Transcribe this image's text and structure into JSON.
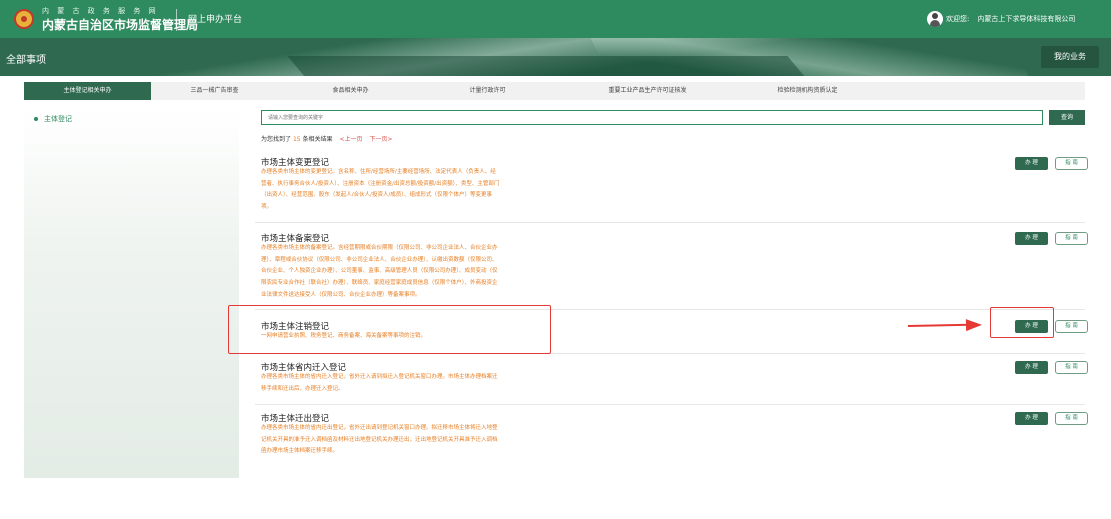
{
  "header": {
    "brand_subtitle": "内 蒙 古 政 务 服 务 网",
    "brand_title": "内蒙古自治区市场监督管理局",
    "platform_label": "网上申办平台",
    "welcome_text": "欢迎您:",
    "company_name": "内蒙古上下求导体科技有限公司"
  },
  "banner": {
    "all_items_label": "全部事项",
    "my_business_label": "我的业务"
  },
  "tabs": [
    {
      "label": "主体登记相关申办",
      "active": true
    },
    {
      "label": "三品一械广告审查",
      "active": false
    },
    {
      "label": "食品相关申办",
      "active": false
    },
    {
      "label": "计量行政许可",
      "active": false
    },
    {
      "label": "重要工业产品生产许可证核发",
      "active": false
    },
    {
      "label": "检验检测机构资质认定",
      "active": false
    }
  ],
  "sidebar": {
    "items": [
      {
        "label": "主体登记"
      }
    ]
  },
  "search": {
    "placeholder": "请输入您要查询的关键字",
    "button_label": "查询"
  },
  "results": {
    "prefix": "为您找到了",
    "count": "15",
    "suffix": "条相关结果",
    "prev_label": "<上一页",
    "next_label": "下一页>"
  },
  "items": [
    {
      "title": "市场主体变更登记",
      "description": "办理各类市场主体的变更登记。含名称、住所/经营场所/主要经营场所、法定代表人（负责人、经营者、执行事务合伙人/投资人）、注册资本（注册资金/出资总额/投资额/出资额）、类型、主管部门（出资人）、经营范围、股东（发起人/合伙人/投资人/成员）、组成形式（仅限个体户）等变更事项。",
      "do_label": "办 理",
      "guide_label": "指 南"
    },
    {
      "title": "市场主体备案登记",
      "description": "办理各类市场主体的备案登记。含经营期限或合伙期限（仅限公司、非公司企业法人、合伙企业办理）、章程或合伙协议（仅限公司、非公司企业法人、合伙企业办理）、认缴出资数额（仅限公司、合伙企业、个人独资企业办理）、公司董事、监事、高级管理人员（仅限公司办理）、成员变动（仅限农民专业合作社（联合社）办理）、联络员、家庭经营家庭成员信息（仅限个体户）、外商投资企业法律文件送达接受人（仅限公司、合伙企业办理）等备案事项。",
      "do_label": "办 理",
      "guide_label": "指 南"
    },
    {
      "title": "市场主体注销登记",
      "description": "一网申请营业执照、税务登记、商务备案、海关备案等事项的注销。",
      "do_label": "办 理",
      "guide_label": "指 南"
    },
    {
      "title": "市场主体省内迁入登记",
      "description": "办理各类市场主体的省内迁入登记，省外迁入请到拟迁入登记机关窗口办理。市场主体办理档案迁移手续和迁出后，办理迁入登记。",
      "do_label": "办 理",
      "guide_label": "指 南"
    },
    {
      "title": "市场主体迁出登记",
      "description": "办理各类市场主体的省内迁出登记，省外迁出请到登记机关窗口办理。拟迁移市场主体将迁入地登记机关开具的准予迁入调档函及材料迁出地登记机关办理迁出，迁出地登记机关开具准予迁入调档函办理市场主体档案迁移手续。",
      "do_label": "办 理",
      "guide_label": "指 南"
    }
  ]
}
